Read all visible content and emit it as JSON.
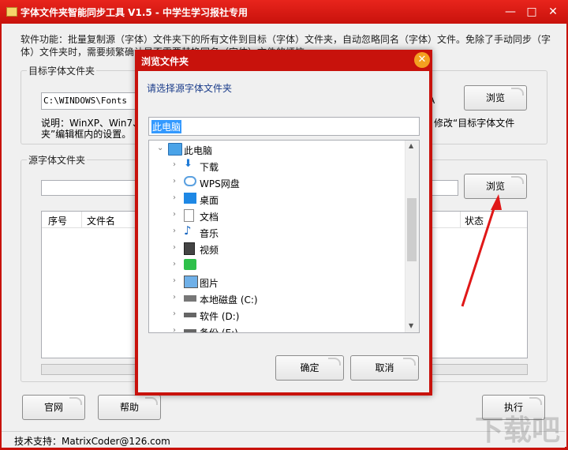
{
  "window": {
    "title": "字体文件夹智能同步工具 V1.5 - 中学生学习报社专用",
    "controls": {
      "min": "—",
      "max": "□",
      "close": "✕"
    }
  },
  "description": "软件功能：批量复制源（字体）文件夹下的所有文件到目标（字体）文件夹，自动忽略同名（字体）文件。免除了手动同步（字体）文件夹时，需要频繁确认是否需要替换同名（字体）文件的烦恼。",
  "target_group": {
    "title": "目标字体文件夹",
    "path_value": "C:\\WINDOWS\\Fonts",
    "browse_label": "浏览",
    "note_left": "说明：WinXP、Win7、W",
    "note_right": "修改“目标字体文件",
    "note_line2": "夹”编辑框内的设置。",
    "partial_char": "A"
  },
  "source_group": {
    "title": "源字体文件夹",
    "path_value": "",
    "browse_label": "浏览",
    "columns": [
      "序号",
      "文件名",
      "状态"
    ]
  },
  "bottom_buttons": {
    "website": "官网",
    "help": "帮助",
    "execute": "执行"
  },
  "status": {
    "support": "技术支持：MatrixCoder@126.com"
  },
  "watermark": "下载吧",
  "dialog": {
    "title": "浏览文件夹",
    "close": "✕",
    "prompt": "请选择源字体文件夹",
    "selected_value": "此电脑",
    "tree": [
      {
        "label": "此电脑",
        "icon": "monitor-icon",
        "level": 0,
        "expanded": true
      },
      {
        "label": "下载",
        "icon": "download-icon",
        "level": 1
      },
      {
        "label": "WPS网盘",
        "icon": "cloud-icon",
        "level": 1
      },
      {
        "label": "桌面",
        "icon": "desktop-icon",
        "level": 1
      },
      {
        "label": "文档",
        "icon": "document-icon",
        "level": 1
      },
      {
        "label": "音乐",
        "icon": "music-icon",
        "level": 1
      },
      {
        "label": "视频",
        "icon": "video-icon",
        "level": 1
      },
      {
        "label": "",
        "icon": "green-app-icon",
        "level": 1
      },
      {
        "label": "图片",
        "icon": "picture-icon",
        "level": 1
      },
      {
        "label": "本地磁盘 (C:)",
        "icon": "windows-drive-icon",
        "level": 1
      },
      {
        "label": "软件 (D:)",
        "icon": "drive-icon",
        "level": 1
      },
      {
        "label": "备份 (E:)",
        "icon": "drive-icon",
        "level": 1
      }
    ],
    "ok_label": "确定",
    "cancel_label": "取消"
  },
  "colors": {
    "title_red": "#c8120c",
    "selection_blue": "#3399ff",
    "annotation_red": "#e01818"
  }
}
